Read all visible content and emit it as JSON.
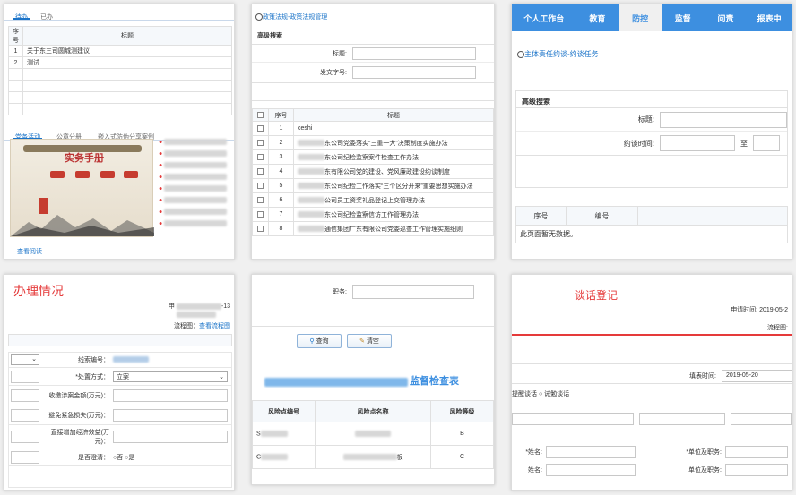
{
  "p1": {
    "tabs": [
      "待办",
      "已办"
    ],
    "table_headers": [
      "序号",
      "标题"
    ],
    "rows": [
      {
        "no": "1",
        "title": "关于东三司圆城测建议"
      },
      {
        "no": "2",
        "title": "测试"
      }
    ],
    "tabs2": [
      "党务活动",
      "公章分册",
      "嵌入式防伪分享案例"
    ],
    "book_title": "实务手册",
    "news_count": 8,
    "footer_link": "查看阅读"
  },
  "p2": {
    "breadcrumb": "政策法规-政策法规管理",
    "search_title": "高级搜索",
    "field_title": "标题:",
    "field_doc": "发文字号:",
    "headers": [
      "序号",
      "标题"
    ],
    "rows": [
      {
        "no": "1",
        "title": "ceshi"
      },
      {
        "no": "2",
        "title": "东公司党委落实“三重一大”决策制度实施办法"
      },
      {
        "no": "3",
        "title": "东公司纪检监察案件检查工作办法"
      },
      {
        "no": "4",
        "title": "东有限公司党的建设、党风廉政建设约谈制度"
      },
      {
        "no": "5",
        "title": "东公司纪检工作落实“三个区分开来”重要思想实施办法"
      },
      {
        "no": "6",
        "title": "公司员工资奖礼品登记上交管理办法"
      },
      {
        "no": "7",
        "title": "东公司纪检监察信访工作管理办法"
      },
      {
        "no": "8",
        "title": "通信集团广东有限公司党委巡查工作管理实施细则"
      }
    ]
  },
  "p3": {
    "nav": [
      "个人工作台",
      "教育",
      "防控",
      "监督",
      "问责",
      "报表中"
    ],
    "active_nav": 2,
    "breadcrumb": "主体责任约谈-约谈任务",
    "search_title": "高级搜索",
    "field_title": "标题:",
    "field_time": "约谈时间:",
    "to": "至",
    "headers": [
      "序号",
      "编号"
    ],
    "empty": "此页面暂无数据。"
  },
  "p4": {
    "title": "办理情况",
    "meta": "申",
    "meta_suffix": "-13",
    "flow_label": "流程图：",
    "flow_link": "查看流程图",
    "rows": [
      {
        "label": "线索编号：",
        "value": ""
      },
      {
        "label": "*处置方式：",
        "value": "立案"
      },
      {
        "label": "收缴涉案金额(万元)：",
        "value": ""
      },
      {
        "label": "避免紧急损失(万元)：",
        "value": ""
      },
      {
        "label": "直接增加经济效益(万元)：",
        "value": ""
      },
      {
        "label": "是否澄清：",
        "value": "○否 ○是"
      }
    ]
  },
  "p5": {
    "field_duty": "职务:",
    "btn_search": "查询",
    "btn_clear": "清空",
    "heading": "监督检查表",
    "headers": [
      "风险点编号",
      "风险点名称",
      "风险等级"
    ],
    "rows": [
      {
        "code": "S",
        "name": "",
        "level": "B"
      },
      {
        "code": "G",
        "name": "板",
        "level": "C"
      }
    ]
  },
  "p6": {
    "title": "谈话登记",
    "apply_time": "申请时间: 2019-05-2",
    "flow_label": "流程图:",
    "fill_time_label": "填表时间:",
    "fill_time": "2019-05-20",
    "radio_text": "提醒谈话 ○ 诫勉谈话",
    "name_label": "*姓名:",
    "unit_label": "*单位及职务:",
    "name_label2": "姓名:",
    "unit_label2": "单位及职务:"
  },
  "colors": {
    "blue": "#1a73c8",
    "nav": "#3d8fe0",
    "red": "#e53a3a"
  }
}
